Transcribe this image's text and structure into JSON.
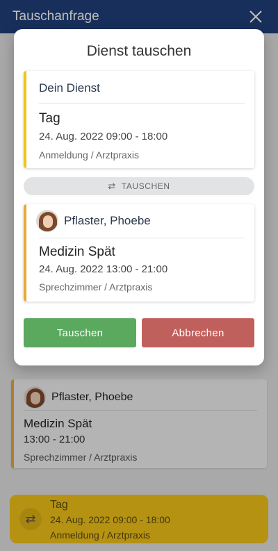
{
  "topbar": {
    "title": "Tauschanfrage",
    "close_icon": "close-icon"
  },
  "background": {
    "person_card": {
      "name": "Pflaster, Phoebe",
      "shift": "Medizin Spät",
      "time": "13:00 - 21:00",
      "location": "Sprechzimmer / Arztpraxis"
    },
    "selected_shift": {
      "shift": "Tag",
      "datetime": "24. Aug. 2022  09:00 - 18:00",
      "location": "Anmeldung / Arztpraxis",
      "icon": "swap-icon"
    }
  },
  "dialog": {
    "title": "Dienst tauschen",
    "own": {
      "header": "Dein Dienst",
      "shift": "Tag",
      "datetime": "24. Aug. 2022  09:00 - 18:00",
      "location": "Anmeldung / Arztpraxis"
    },
    "swap_label": "TAUSCHEN",
    "swap_icon": "⇄",
    "other": {
      "name": "Pflaster, Phoebe",
      "shift": "Medizin Spät",
      "datetime": "24. Aug. 2022  13:00 - 21:00",
      "location": "Sprechzimmer / Arztpraxis"
    },
    "buttons": {
      "confirm": "Tauschen",
      "cancel": "Abbrechen"
    }
  },
  "colors": {
    "topbar": "#1f3f78",
    "confirm": "#5ba85f",
    "cancel": "#c0605d",
    "accent_yellow": "#f2c318",
    "accent_orange": "#e8a93a"
  }
}
